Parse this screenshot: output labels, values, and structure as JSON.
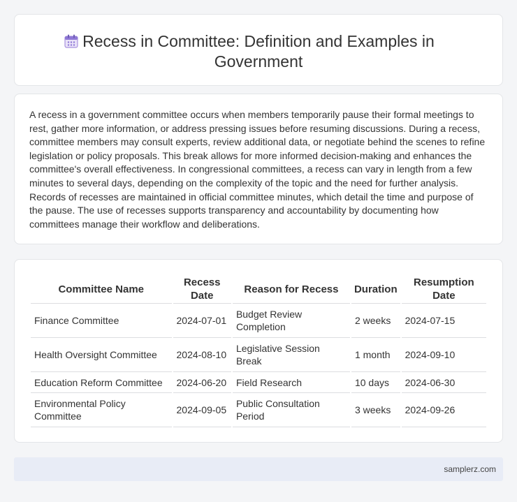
{
  "header": {
    "icon": "calendar-icon",
    "title": "Recess in Committee: Definition and Examples in Government"
  },
  "intro": "A recess in a government committee occurs when members temporarily pause their formal meetings to rest, gather more information, or address pressing issues before resuming discussions. During a recess, committee members may consult experts, review additional data, or negotiate behind the scenes to refine legislation or policy proposals. This break allows for more informed decision-making and enhances the committee's overall effectiveness. In congressional committees, a recess can vary in length from a few minutes to several days, depending on the complexity of the topic and the need for further analysis. Records of recesses are maintained in official committee minutes, which detail the time and purpose of the pause. The use of recesses supports transparency and accountability by documenting how committees manage their workflow and deliberations.",
  "table": {
    "headers": [
      "Committee Name",
      "Recess Date",
      "Reason for Recess",
      "Duration",
      "Resumption Date"
    ],
    "rows": [
      [
        "Finance Committee",
        "2024-07-01",
        "Budget Review Completion",
        "2 weeks",
        "2024-07-15"
      ],
      [
        "Health Oversight Committee",
        "2024-08-10",
        "Legislative Session Break",
        "1 month",
        "2024-09-10"
      ],
      [
        "Education Reform Committee",
        "2024-06-20",
        "Field Research",
        "10 days",
        "2024-06-30"
      ],
      [
        "Environmental Policy Committee",
        "2024-09-05",
        "Public Consultation Period",
        "3 weeks",
        "2024-09-26"
      ]
    ]
  },
  "footer": {
    "source": "samplerz.com"
  }
}
